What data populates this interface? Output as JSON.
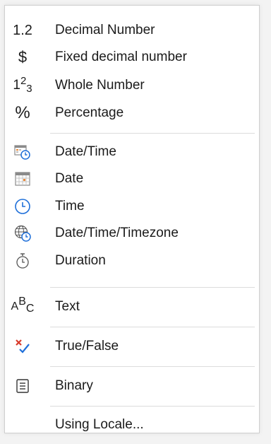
{
  "menu": {
    "items": [
      {
        "label": "Decimal Number",
        "icon": "decimal-icon"
      },
      {
        "label": "Fixed decimal number",
        "icon": "dollar-icon"
      },
      {
        "label": "Whole Number",
        "icon": "whole-number-icon"
      },
      {
        "label": "Percentage",
        "icon": "percent-icon"
      },
      {
        "label": "Date/Time",
        "icon": "datetime-icon"
      },
      {
        "label": "Date",
        "icon": "calendar-icon"
      },
      {
        "label": "Time",
        "icon": "clock-icon"
      },
      {
        "label": "Date/Time/Timezone",
        "icon": "globe-clock-icon"
      },
      {
        "label": "Duration",
        "icon": "stopwatch-icon"
      },
      {
        "label": "Text",
        "icon": "text-abc-icon"
      },
      {
        "label": "True/False",
        "icon": "true-false-icon"
      },
      {
        "label": "Binary",
        "icon": "binary-icon"
      },
      {
        "label": "Using Locale...",
        "icon": ""
      }
    ],
    "icon_text": {
      "decimal": "1.2",
      "dollar": "$",
      "whole_base": "1",
      "whole_sup": "2",
      "whole_sub": "3",
      "percent": "%",
      "abc_a": "A",
      "abc_b": "B",
      "abc_c": "C"
    },
    "colors": {
      "accent_blue": "#1e6fd9",
      "false_red": "#d83b2c",
      "calendar_orange": "#e8893a"
    }
  }
}
